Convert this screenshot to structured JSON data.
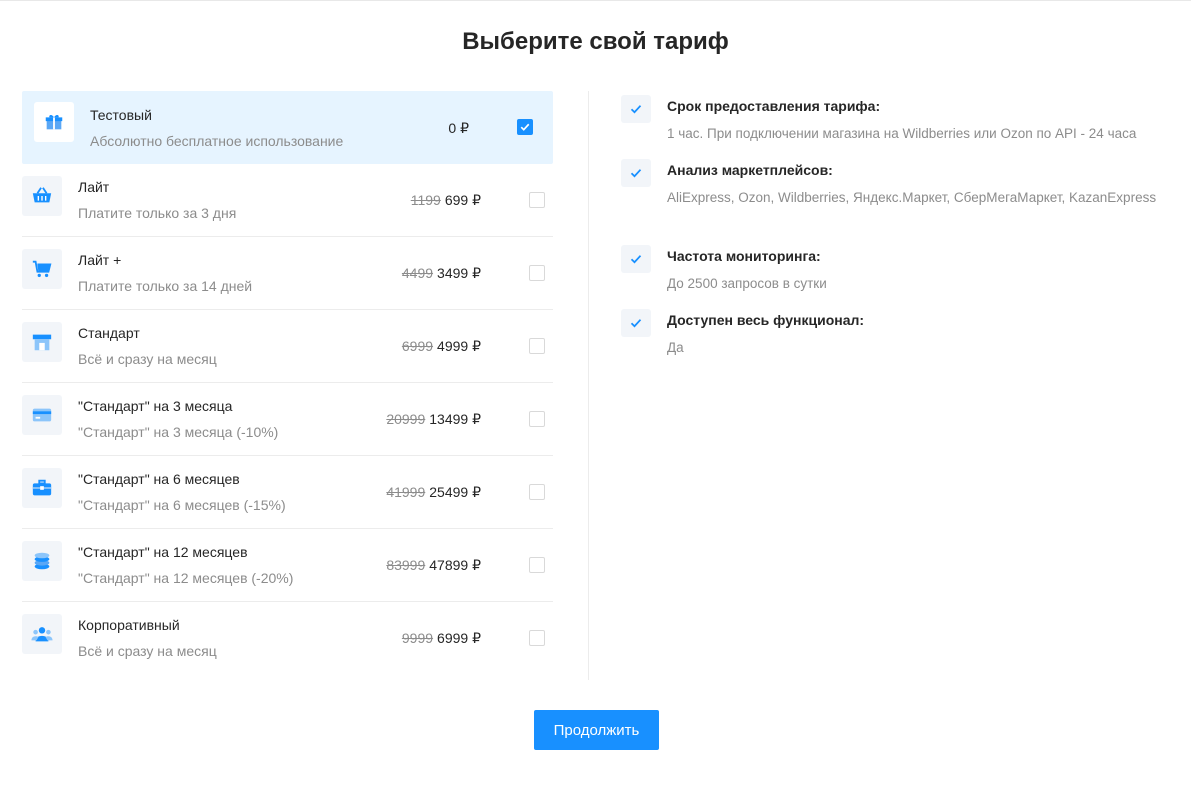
{
  "page": {
    "title": "Выберите свой тариф"
  },
  "colors": {
    "accent": "#1890ff",
    "selected_bg": "#e6f4ff",
    "muted": "#8c8c8c"
  },
  "plans": [
    {
      "icon": "gift-box-icon",
      "title": "Тестовый",
      "subtitle": "Абсолютно бесплатное использование",
      "old_price": "",
      "price": "0 ₽",
      "selected": true
    },
    {
      "icon": "basket-icon",
      "title": "Лайт",
      "subtitle": "Платите только за 3 дня",
      "old_price": "1199",
      "price": "699 ₽",
      "selected": false
    },
    {
      "icon": "shopping-cart-icon",
      "title": "Лайт +",
      "subtitle": "Платите только за 14 дней",
      "old_price": "4499",
      "price": "3499 ₽",
      "selected": false
    },
    {
      "icon": "storefront-icon",
      "title": "Стандарт",
      "subtitle": "Всё и сразу на месяц",
      "old_price": "6999",
      "price": "4999 ₽",
      "selected": false
    },
    {
      "icon": "credit-card-icon",
      "title": "\"Стандарт\" на 3 месяца",
      "subtitle": "\"Стандарт\" на 3 месяца (-10%)",
      "old_price": "20999",
      "price": "13499 ₽",
      "selected": false
    },
    {
      "icon": "briefcase-icon",
      "title": "\"Стандарт\" на 6 месяцев",
      "subtitle": "\"Стандарт\" на 6 месяцев (-15%)",
      "old_price": "41999",
      "price": "25499 ₽",
      "selected": false
    },
    {
      "icon": "coins-stack-icon",
      "title": "\"Стандарт\" на 12 месяцев",
      "subtitle": "\"Стандарт\" на 12 месяцев (-20%)",
      "old_price": "83999",
      "price": "47899 ₽",
      "selected": false
    },
    {
      "icon": "users-group-icon",
      "title": "Корпоративный",
      "subtitle": "Всё и сразу на месяц",
      "old_price": "9999",
      "price": "6999 ₽",
      "selected": false
    }
  ],
  "features": [
    {
      "title": "Срок предоставления тарифа:",
      "text": "1 час. При подключении магазина на Wildberries или Ozon по API - 24 часа"
    },
    {
      "title": "Анализ маркетплейсов:",
      "text": "AliExpress, Ozon, Wildberries, Яндекс.Маркет, СберМегаМаркет, KazanExpress"
    },
    {
      "title": "Частота мониторинга:",
      "text": "До 2500 запросов в сутки"
    },
    {
      "title": "Доступен весь функционал:",
      "text": "Да"
    }
  ],
  "actions": {
    "continue_label": "Продолжить"
  }
}
